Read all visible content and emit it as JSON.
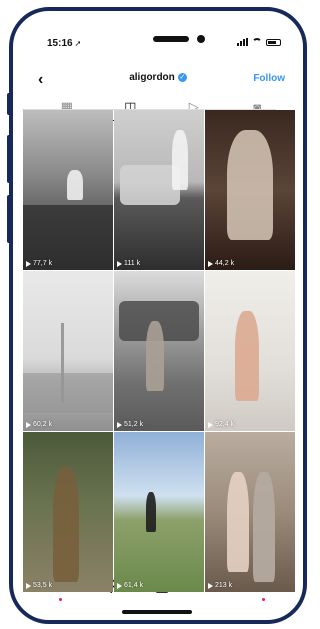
{
  "status": {
    "time": "15:16",
    "location_glyph": "➚"
  },
  "header": {
    "back_glyph": "‹",
    "username": "aligordon",
    "verified_glyph": "✓",
    "follow_label": "Follow"
  },
  "tabs": [
    {
      "name": "grid",
      "glyph": "▦"
    },
    {
      "name": "reels",
      "glyph": "◫"
    },
    {
      "name": "videos",
      "glyph": "▷"
    },
    {
      "name": "tagged",
      "glyph": "◙"
    }
  ],
  "grid": [
    {
      "views": "77,7 k"
    },
    {
      "views": "111 k"
    },
    {
      "views": "44,2 k"
    },
    {
      "views": "60,2 k"
    },
    {
      "views": "51,2 k"
    },
    {
      "views": "92,4 k"
    },
    {
      "views": "53,5 k"
    },
    {
      "views": "61,4 k"
    },
    {
      "views": "213 k"
    }
  ],
  "bottom_nav": [
    {
      "name": "home",
      "glyph": "⌂"
    },
    {
      "name": "search",
      "glyph": "⚲"
    },
    {
      "name": "reels",
      "glyph": "◫"
    },
    {
      "name": "shop",
      "glyph": "⎙"
    },
    {
      "name": "profile",
      "glyph": "●"
    }
  ],
  "colors": {
    "accent": "#3897f0",
    "frame": "#16295a",
    "notification": "#e0245e"
  }
}
